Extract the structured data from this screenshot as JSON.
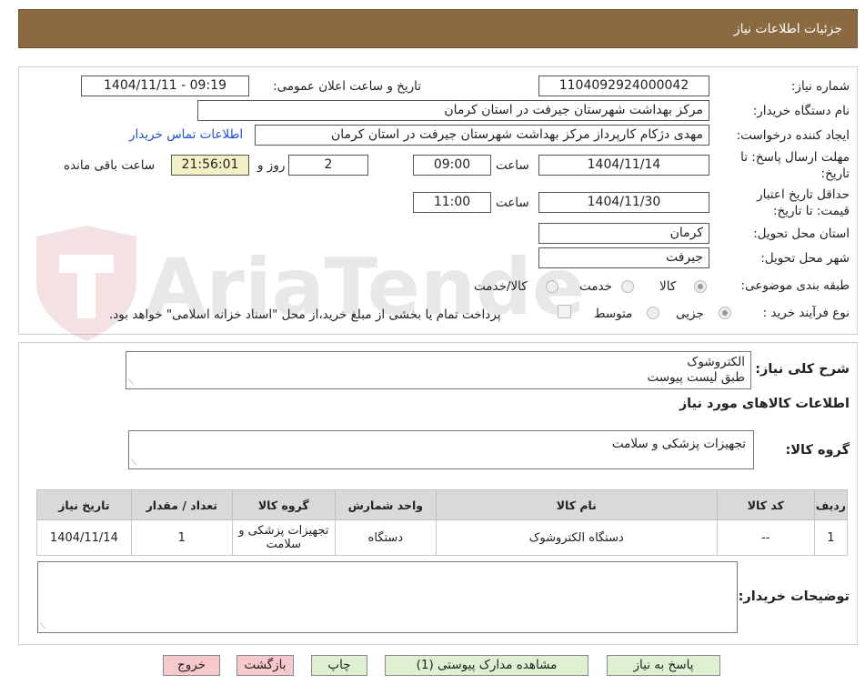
{
  "header": {
    "title": "جزئیات اطلاعات نیاز"
  },
  "watermark": {
    "text": "AriaTender.neT"
  },
  "form": {
    "need_number_label": "شماره نیاز:",
    "need_number": "1104092924000042",
    "announce_label": "تاریخ و ساعت اعلان عمومی:",
    "announce_value": "1404/11/11 - 09:19",
    "buyer_org_label": "نام دستگاه خریدار:",
    "buyer_org": "مرکز بهداشت شهرستان جیرفت در استان کرمان",
    "requester_label": "ایجاد کننده درخواست:",
    "requester": "مهدی دژکام کارپرداز مرکز بهداشت شهرستان جیرفت در استان کرمان",
    "contact_link": "اطلاعات تماس خریدار",
    "deadline_label_1": "مهلت ارسال پاسخ: تا",
    "deadline_label_2": "تاریخ:",
    "deadline_date": "1404/11/14",
    "time_label": "ساعت",
    "deadline_time": "09:00",
    "days_value": "2",
    "days_label": "روز و",
    "remaining_time": "21:56:01",
    "remaining_label": "ساعت باقی مانده",
    "validity_label_1": "حداقل تاریخ اعتبار",
    "validity_label_2": "قیمت: تا تاریخ:",
    "validity_date": "1404/11/30",
    "validity_time_label": "ساعت",
    "validity_time": "11:00",
    "province_label": "استان محل تحویل:",
    "province": "کرمان",
    "city_label": "شهر محل تحویل:",
    "city": "جیرفت",
    "category_label": "طبقه بندی موضوعی:",
    "category_options": [
      "کالا",
      "خدمت",
      "کالا/خدمت"
    ],
    "category_selected": "کالا",
    "process_label": "نوع فرآیند خرید :",
    "process_options": [
      "جزیی",
      "متوسط"
    ],
    "process_selected": "جزیی",
    "treasury_text": "پرداخت تمام یا بخشی از مبلغ خرید،از محل \"اسناد خزانه اسلامی\" خواهد بود."
  },
  "details": {
    "summary_label": "شرح کلی نیاز:",
    "summary_line1": "الکتروشوک",
    "summary_line2": "طبق لیست پیوست",
    "goods_info_title": "اطلاعات کالاهای مورد نیاز",
    "goods_group_label": "گروه کالا:",
    "goods_group_value": "تجهیزات پزشکی و سلامت",
    "table": {
      "headers": [
        "ردیف",
        "کد کالا",
        "نام کالا",
        "واحد شمارش",
        "گروه کالا",
        "تعداد / مقدار",
        "تاریخ نیاز"
      ],
      "rows": [
        {
          "row": "1",
          "code": "--",
          "name": "دستگاه الکتروشوک",
          "unit": "دستگاه",
          "group": "تجهیزات پزشکی و سلامت",
          "qty": "1",
          "date": "1404/11/14"
        }
      ]
    },
    "buyer_notes_label": "توضیحات خریدار:",
    "buyer_notes_value": ""
  },
  "buttons": {
    "reply": "پاسخ به نیاز",
    "view_docs": "مشاهده مدارک پیوستی (1)",
    "print": "چاپ",
    "back": "بازگشت",
    "exit": "خروج"
  },
  "colors": {
    "header_bg": "#8b6a42",
    "button_green": "#dff0d2",
    "button_pink": "#f7c8cc",
    "link": "#1a4fd6",
    "remaining_bg": "#f3f0c6"
  }
}
